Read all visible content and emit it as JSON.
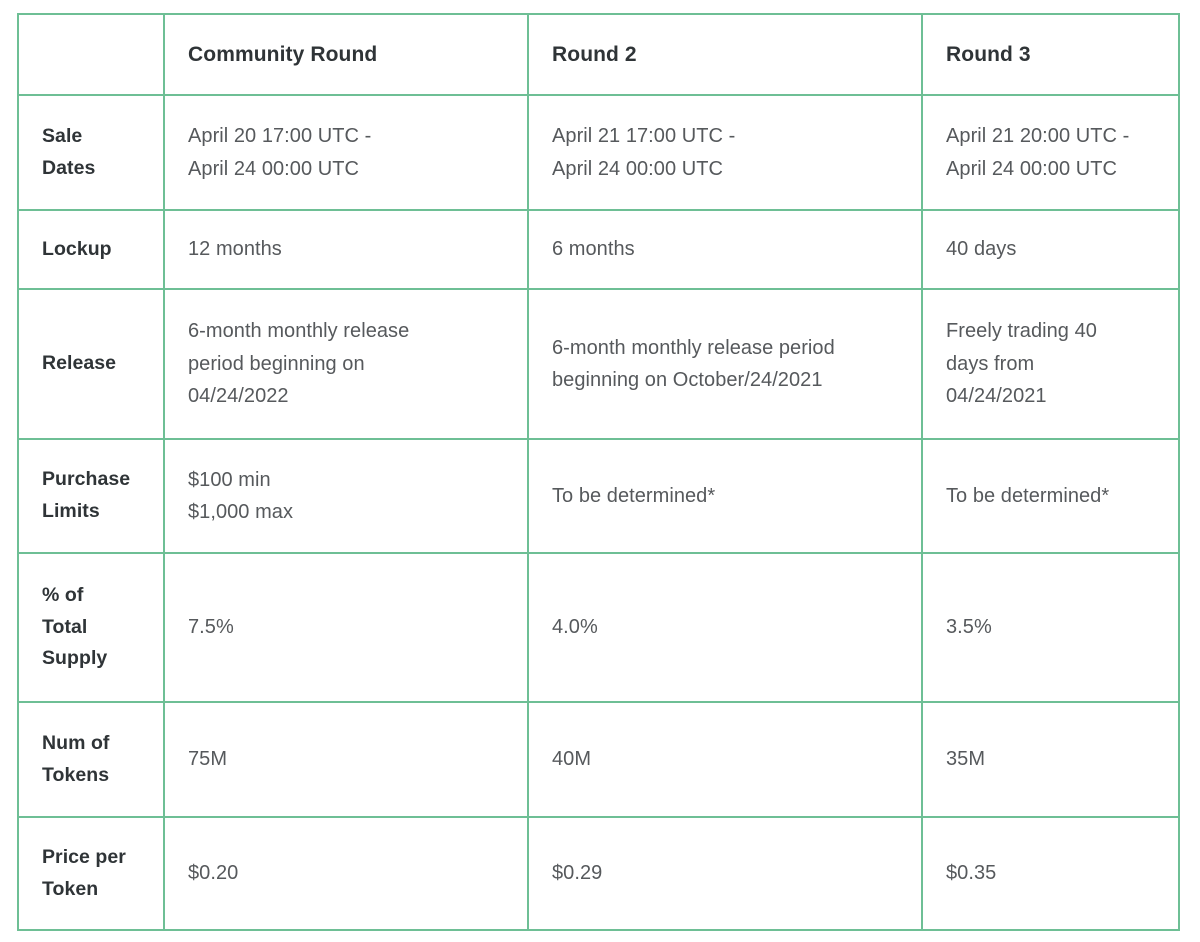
{
  "table": {
    "columns": [
      {
        "key": "label",
        "header": ""
      },
      {
        "key": "round1",
        "header": "Community Round"
      },
      {
        "key": "round2",
        "header": "Round 2"
      },
      {
        "key": "round3",
        "header": "Round 3"
      }
    ],
    "rows": [
      {
        "label": "Sale Dates",
        "label_lines": [
          "Sale",
          "Dates"
        ],
        "round1": "April 20 17:00 UTC - April 24 00:00 UTC",
        "round1_lines": [
          "April 20 17:00 UTC -",
          "April 24 00:00 UTC"
        ],
        "round2": "April 21 17:00 UTC - April 24 00:00 UTC",
        "round2_lines": [
          "April 21 17:00 UTC -",
          "April 24 00:00 UTC"
        ],
        "round3": "April 21 20:00 UTC - April 24 00:00 UTC",
        "round3_lines": [
          "April 21 20:00 UTC -",
          "April 24 00:00 UTC"
        ]
      },
      {
        "label": "Lockup",
        "label_lines": [
          "Lockup"
        ],
        "round1": "12 months",
        "round2": "6 months",
        "round3": "40 days"
      },
      {
        "label": "Release",
        "label_lines": [
          "Release"
        ],
        "round1": "6-month monthly release period beginning on 04/24/2022",
        "round1_lines": [
          "6-month monthly release",
          "period beginning on",
          "04/24/2022"
        ],
        "round2": "6-month monthly release period beginning on October/24/2021",
        "round2_lines": [
          "6-month monthly release period",
          "beginning on October/24/2021"
        ],
        "round3": "Freely trading 40 days from 04/24/2021",
        "round3_lines": [
          "Freely trading 40",
          "days from",
          "04/24/2021"
        ]
      },
      {
        "label": "Purchase Limits",
        "label_lines": [
          "Purchase",
          "Limits"
        ],
        "round1": "$100 min $1,000 max",
        "round1_lines": [
          "$100 min",
          "$1,000 max"
        ],
        "round2": "To be determined*",
        "round3": "To be determined*"
      },
      {
        "label": "% of Total Supply",
        "label_lines": [
          "% of",
          "Total",
          "Supply"
        ],
        "round1": "7.5%",
        "round2": "4.0%",
        "round3": "3.5%"
      },
      {
        "label": "Num of Tokens",
        "label_lines": [
          "Num of",
          "Tokens"
        ],
        "round1": "75M",
        "round2": "40M",
        "round3": "35M"
      },
      {
        "label": "Price per Token",
        "label_lines": [
          "Price per",
          "Token"
        ],
        "round1": "$0.20",
        "round2": "$0.29",
        "round3": "$0.35"
      }
    ]
  },
  "colors": {
    "border": "#6ebf95",
    "header_text": "#2f3437",
    "label_text": "#2f3437",
    "value_text": "#56595c",
    "background": "#ffffff"
  }
}
